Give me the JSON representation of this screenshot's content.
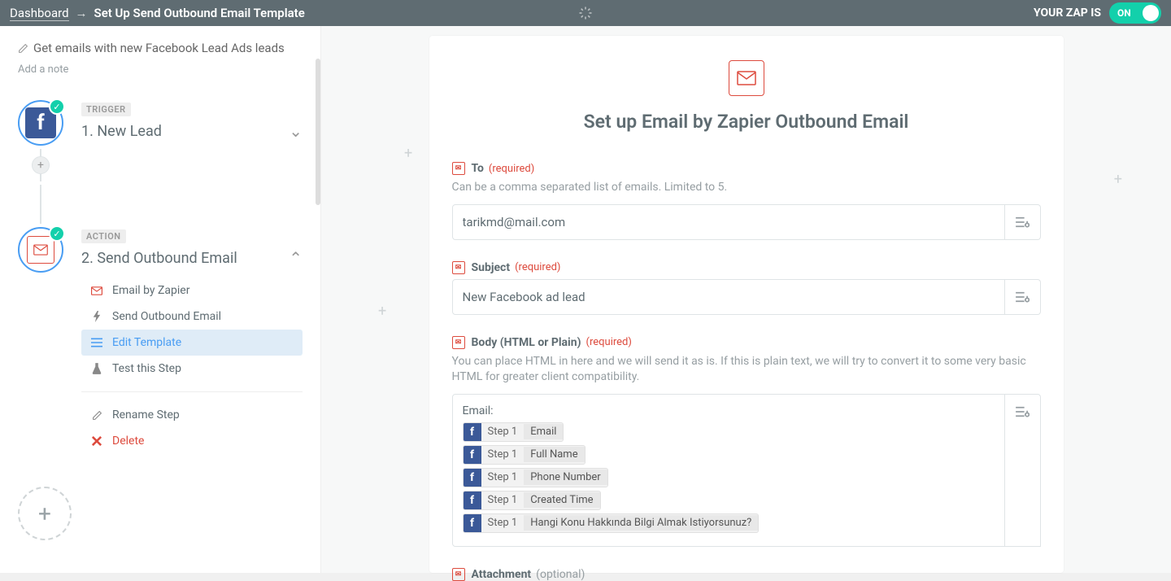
{
  "header": {
    "dashboard": "Dashboard",
    "title": "Set Up Send Outbound Email Template",
    "status_label": "YOUR ZAP IS",
    "toggle": "ON"
  },
  "sidebar": {
    "zap_name": "Get emails with new Facebook Lead Ads leads",
    "add_note": "Add a note",
    "trigger": {
      "badge": "TRIGGER",
      "title": "1. New Lead"
    },
    "action": {
      "badge": "ACTION",
      "title": "2. Send Outbound Email",
      "items": {
        "app": "Email by Zapier",
        "event": "Send Outbound Email",
        "template": "Edit Template",
        "test": "Test this Step",
        "rename": "Rename Step",
        "delete": "Delete"
      }
    }
  },
  "panel": {
    "title": "Set up Email by Zapier Outbound Email",
    "to": {
      "label": "To",
      "required": "(required)",
      "help": "Can be a comma separated list of emails. Limited to 5.",
      "value": "tarikmd@mail.com"
    },
    "subject": {
      "label": "Subject",
      "required": "(required)",
      "value": "New Facebook ad lead"
    },
    "body": {
      "label": "Body (HTML or Plain)",
      "required": "(required)",
      "help": "You can place HTML in here and we will send it as is. If this is plain text, we will try to convert it to some very basic HTML for greater client compatibility.",
      "prefix": "Email:",
      "step_label": "Step 1",
      "pills": [
        "Email",
        "Full Name",
        "Phone Number",
        "Created Time",
        "Hangi Konu Hakkında Bilgi Almak Istiyorsunuz?"
      ]
    },
    "attachment": {
      "label": "Attachment",
      "optional": "(optional)"
    }
  }
}
